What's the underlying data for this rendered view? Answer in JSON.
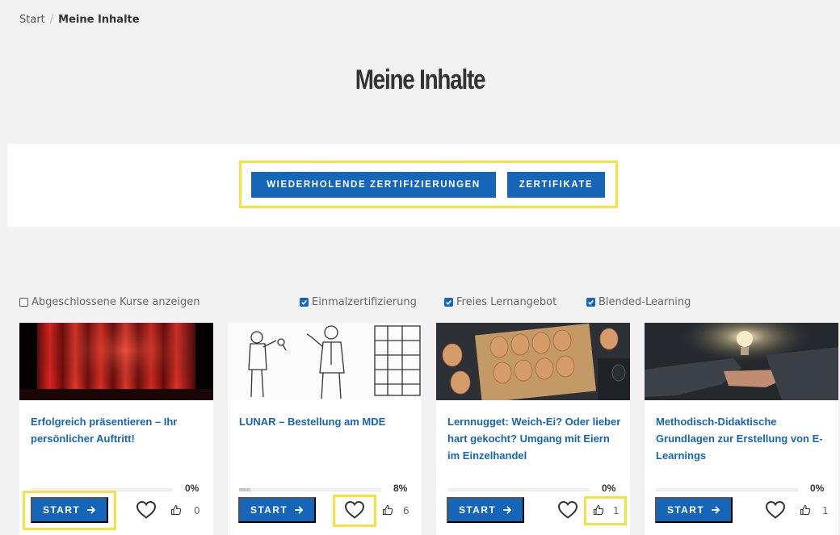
{
  "breadcrumb": {
    "home": "Start",
    "separator": "/",
    "current": "Meine Inhalte"
  },
  "page": {
    "title": "Meine Inhalte"
  },
  "actions": {
    "recurring_label": "WIEDERHOLENDE ZERTIFIZIERUNGEN",
    "certificates_label": "ZERTIFIKATE"
  },
  "filters": {
    "show_completed": {
      "label": "Abgeschlossene Kurse anzeigen",
      "checked": false
    },
    "one_time": {
      "label": "Einmalzertifizierung",
      "checked": true
    },
    "free": {
      "label": "Freies Lernangebot",
      "checked": true
    },
    "blended": {
      "label": "Blended-Learning",
      "checked": true
    }
  },
  "courses": [
    {
      "title": "Erfolgreich präsentieren – Ihr persönlicher Auftritt!",
      "progress": 0,
      "progress_label": "0%",
      "start_label": "START",
      "likes": "0",
      "image": "theater-curtain"
    },
    {
      "title": "LUNAR – Bestellung am MDE",
      "progress": 8,
      "progress_label": "8%",
      "start_label": "START",
      "likes": "6",
      "image": "sketch-people"
    },
    {
      "title": "Lernnugget: Weich-Ei? Oder lieber hart gekocht? Umgang mit Eiern im Einzelhandel",
      "progress": 0,
      "progress_label": "0%",
      "start_label": "START",
      "likes": "1",
      "image": "egg-carton"
    },
    {
      "title": "Methodisch-Didaktische Grundlagen zur Erstellung von E-Learnings",
      "progress": 0,
      "progress_label": "0%",
      "start_label": "START",
      "likes": "1",
      "image": "lightbulb-hand"
    }
  ],
  "colors": {
    "primary": "#1565b8",
    "highlight": "#f7e23c",
    "background": "#f2f2f2"
  },
  "icons": {
    "start": "arrow-right-icon",
    "favorite": "heart-icon",
    "like": "thumbs-up-icon",
    "checkbox": "checkbox-icon"
  }
}
